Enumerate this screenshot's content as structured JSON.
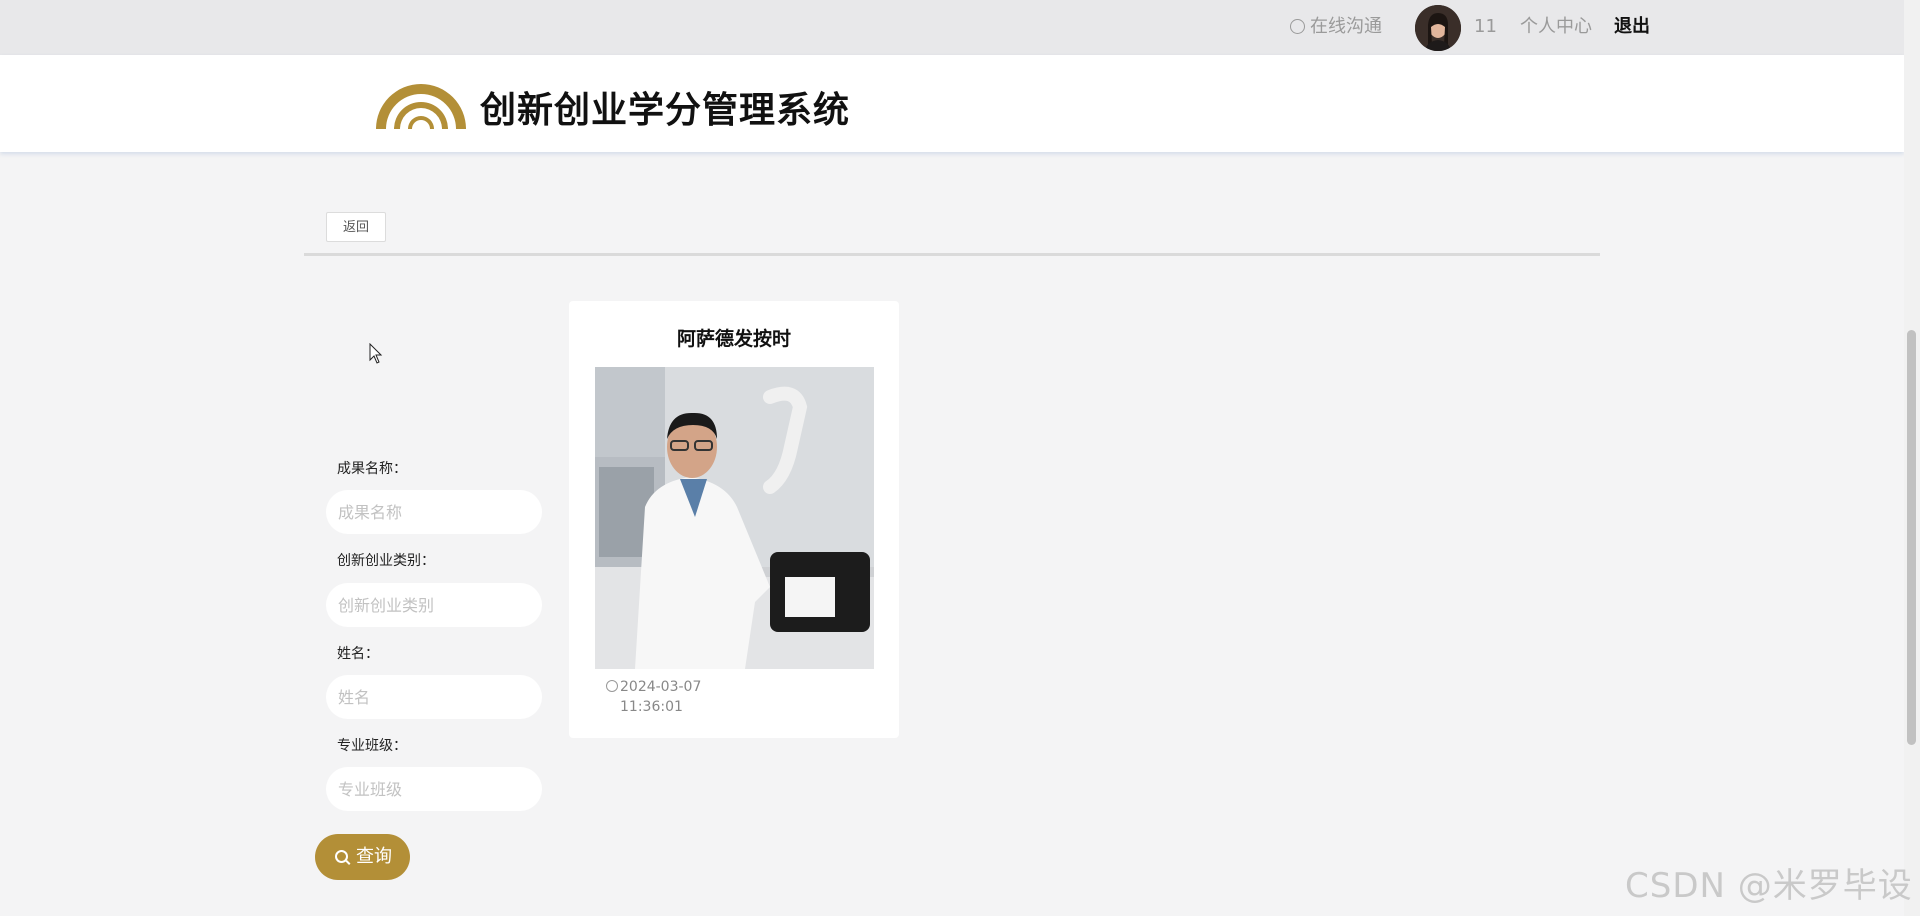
{
  "topbar": {
    "chat_label": "在线沟通",
    "username": "11",
    "center_label": "个人中心",
    "logout_label": "退出"
  },
  "header": {
    "title": "创新创业学分管理系统"
  },
  "back_label": "返回",
  "search_form": {
    "fields": [
      {
        "label": "成果名称：",
        "placeholder": "成果名称",
        "value": ""
      },
      {
        "label": "创新创业类别：",
        "placeholder": "创新创业类别",
        "value": ""
      },
      {
        "label": "姓名：",
        "placeholder": "姓名",
        "value": ""
      },
      {
        "label": "专业班级：",
        "placeholder": "专业班级",
        "value": ""
      }
    ],
    "submit_label": "查询"
  },
  "cards": [
    {
      "title": "阿萨德发按时",
      "date": "2024-03-07",
      "time": "11:36:01"
    }
  ],
  "watermark": "CSDN @米罗毕设",
  "colors": {
    "accent": "#b38f37",
    "topbar": "#e8e8ea",
    "page_bg": "#f4f4f5"
  }
}
